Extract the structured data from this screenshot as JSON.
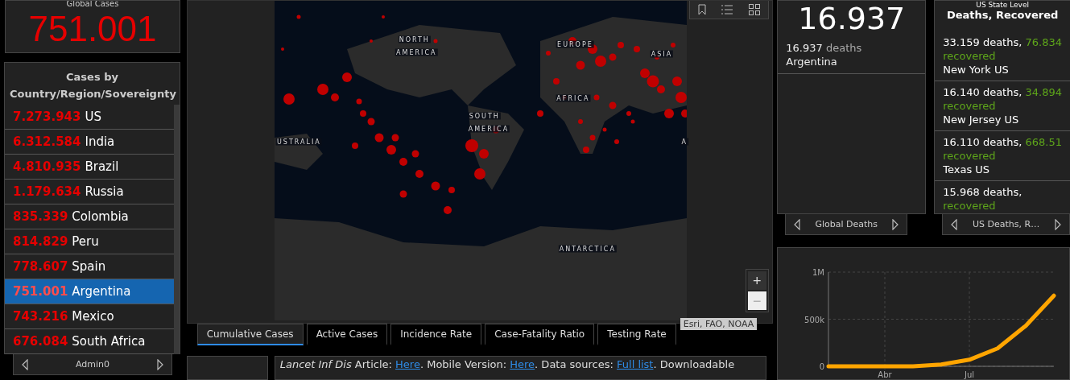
{
  "global_cases": {
    "title": "Global Cases",
    "value": "751.001"
  },
  "cases_list": {
    "title": "Cases by Country/Region/Sovereignty",
    "rows": [
      {
        "count": "7.273.943",
        "name": "US",
        "selected": false
      },
      {
        "count": "6.312.584",
        "name": "India",
        "selected": false
      },
      {
        "count": "4.810.935",
        "name": "Brazil",
        "selected": false
      },
      {
        "count": "1.179.634",
        "name": "Russia",
        "selected": false
      },
      {
        "count": "835.339",
        "name": "Colombia",
        "selected": false
      },
      {
        "count": "814.829",
        "name": "Peru",
        "selected": false
      },
      {
        "count": "778.607",
        "name": "Spain",
        "selected": false
      },
      {
        "count": "751.001",
        "name": "Argentina",
        "selected": true
      },
      {
        "count": "743.216",
        "name": "Mexico",
        "selected": false
      },
      {
        "count": "676.084",
        "name": "South Africa",
        "selected": false
      }
    ],
    "footer": "Admin0"
  },
  "map": {
    "labels": [
      {
        "text": "NORTH"
      },
      {
        "text": "AMERICA"
      },
      {
        "text": "EUROPE"
      },
      {
        "text": "ASIA"
      },
      {
        "text": "AFRICA"
      },
      {
        "text": "SOUTH"
      },
      {
        "text": "AMERICA"
      },
      {
        "text": "USTRALIA"
      },
      {
        "text": "ANTARCTICA"
      },
      {
        "text": "A"
      }
    ],
    "attribution": "Esri, FAO, NOAA",
    "zoom_in": "+",
    "zoom_out": "−"
  },
  "tabs": [
    {
      "label": "Cumulative Cases",
      "selected": true
    },
    {
      "label": "Active Cases",
      "selected": false
    },
    {
      "label": "Incidence Rate",
      "selected": false
    },
    {
      "label": "Case-Fatality Ratio",
      "selected": false
    },
    {
      "label": "Testing Rate",
      "selected": false
    }
  ],
  "info": [
    {
      "kind": "text",
      "text": "*Lancet Inf Dis* Article: "
    },
    {
      "kind": "link",
      "text": "Here"
    },
    {
      "kind": "text",
      "text": ". Mobile Version: "
    },
    {
      "kind": "link",
      "text": "Here"
    },
    {
      "kind": "text",
      "text": ". Data sources: "
    },
    {
      "kind": "link",
      "text": "Full list"
    },
    {
      "kind": "text",
      "text": ". Downloadable"
    }
  ],
  "global_deaths": {
    "value": "16.937",
    "detail_count": "16.937",
    "detail_unit": "deaths",
    "detail_place": "Argentina",
    "footer": "Global Deaths"
  },
  "us_state_level": {
    "subtitle": "US State Level",
    "title": "Deaths, Recovered",
    "items": [
      {
        "deaths": "33.159 deaths,",
        "recovered_count": "76.834",
        "recovered_label": "recovered",
        "place": "New York US"
      },
      {
        "deaths": "16.140 deaths,",
        "recovered_count": "34.894",
        "recovered_label": "recovered",
        "place": "New Jersey US"
      },
      {
        "deaths": "16.110 deaths,",
        "recovered_count": "668.51",
        "recovered_label": "recovered",
        "place": "Texas US"
      },
      {
        "deaths": "15.968 deaths,",
        "recovered_label": "recovered"
      }
    ],
    "footer": "US Deaths, R…"
  },
  "chart": {
    "chart_data": {
      "type": "line",
      "grid": true,
      "categories": [
        null,
        null,
        "Abr",
        null,
        null,
        "Jul",
        null,
        null,
        null
      ],
      "series": [
        {
          "color": "#ffa500",
          "values": [
            0,
            0,
            0,
            0,
            20000,
            70000,
            190000,
            430000,
            750000
          ]
        }
      ],
      "ylim": [
        0,
        1000000
      ],
      "yticks": [
        {
          "value": 0,
          "label": "0"
        },
        {
          "value": 500000,
          "label": "500k"
        },
        {
          "value": 1000000,
          "label": "1M"
        }
      ]
    }
  }
}
